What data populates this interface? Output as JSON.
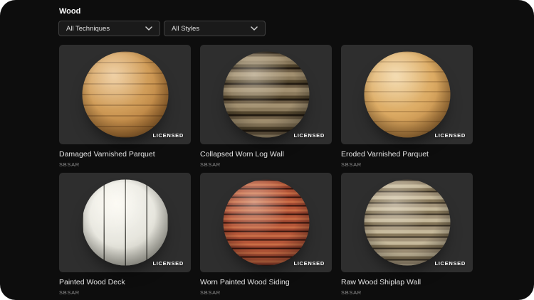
{
  "header": {
    "title": "Wood"
  },
  "filters": [
    {
      "label": "All Techniques",
      "icon": "chevron-down-icon"
    },
    {
      "label": "All Styles",
      "icon": "chevron-down-icon"
    }
  ],
  "cards": [
    {
      "title": "Damaged Varnished Parquet",
      "format": "SBSAR",
      "badge": "LICENSED",
      "material": "orange varnished parquet sphere, horizontal plank seams"
    },
    {
      "title": "Collapsed Worn Log Wall",
      "format": "SBSAR",
      "badge": "LICENSED",
      "material": "gray-brown stacked worn logs sphere, chunky horizontal ridges"
    },
    {
      "title": "Eroded Varnished Parquet",
      "format": "SBSAR",
      "badge": "LICENSED",
      "material": "light tan varnished parquet sphere, horizontal plank seams"
    },
    {
      "title": "Painted Wood Deck",
      "format": "SBSAR",
      "badge": "LICENSED",
      "material": "white painted wood sphere, vertical plank seams"
    },
    {
      "title": "Worn Painted Wood Siding",
      "format": "SBSAR",
      "badge": "LICENSED",
      "material": "red-orange worn painted siding sphere, horizontal slats"
    },
    {
      "title": "Raw Wood Shiplap Wall",
      "format": "SBSAR",
      "badge": "LICENSED",
      "material": "beige raw shiplap sphere, horizontal boards"
    }
  ],
  "colors": {
    "app_background": "#0d0d0d",
    "tile_background": "#2e2e2e",
    "dropdown_background": "#1a1a1a",
    "dropdown_border": "#404040"
  }
}
